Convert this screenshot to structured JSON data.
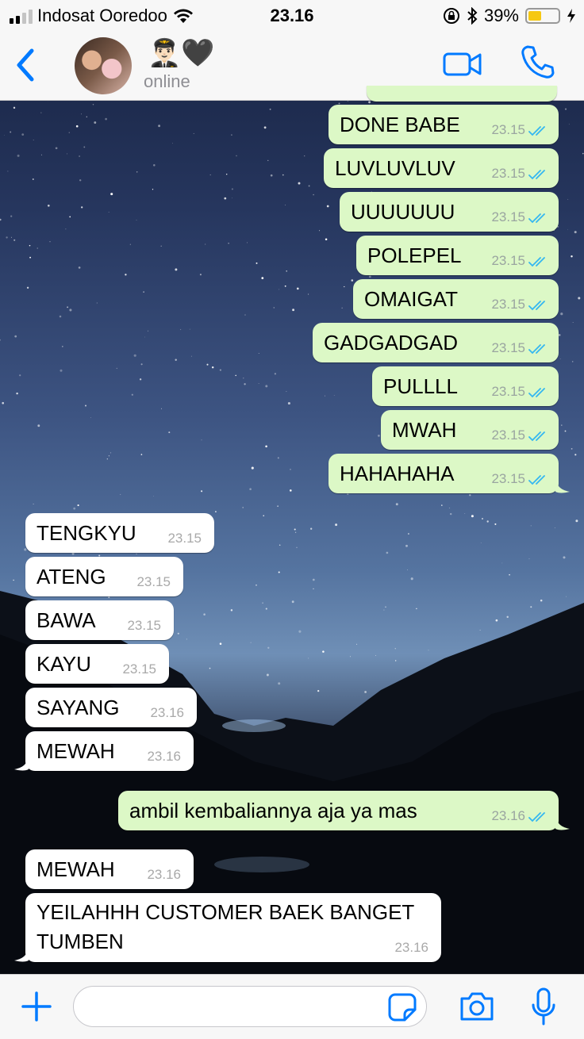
{
  "status_bar": {
    "carrier": "Indosat Ooredoo",
    "time": "23.16",
    "battery": "39%",
    "battery_level": 0.39,
    "icons": [
      "signal-icon",
      "wifi-icon",
      "orientation-lock-icon",
      "bluetooth-icon",
      "battery-icon",
      "charging-icon"
    ]
  },
  "header": {
    "back_icon": "chevron-left-icon",
    "contact_name": "👨🏻‍✈️🖤",
    "contact_status": "online",
    "video_icon": "video-camera-icon",
    "call_icon": "phone-icon"
  },
  "messages": [
    {
      "dir": "out",
      "text": "DONE BABE",
      "time": "23.15",
      "status": "read"
    },
    {
      "dir": "out",
      "text": "LUVLUVLUV",
      "time": "23.15",
      "status": "read"
    },
    {
      "dir": "out",
      "text": "UUUUUUU",
      "time": "23.15",
      "status": "read"
    },
    {
      "dir": "out",
      "text": "POLEPEL",
      "time": "23.15",
      "status": "read"
    },
    {
      "dir": "out",
      "text": "OMAIGAT",
      "time": "23.15",
      "status": "read"
    },
    {
      "dir": "out",
      "text": "GADGADGAD",
      "time": "23.15",
      "status": "read"
    },
    {
      "dir": "out",
      "text": "PULLLL",
      "time": "23.15",
      "status": "read"
    },
    {
      "dir": "out",
      "text": "MWAH",
      "time": "23.15",
      "status": "read"
    },
    {
      "dir": "out",
      "text": "HAHAHAHA",
      "time": "23.15",
      "status": "read"
    },
    {
      "dir": "in",
      "text": "TENGKYU",
      "time": "23.15"
    },
    {
      "dir": "in",
      "text": "ATENG",
      "time": "23.15"
    },
    {
      "dir": "in",
      "text": "BAWA",
      "time": "23.15"
    },
    {
      "dir": "in",
      "text": "KAYU",
      "time": "23.15"
    },
    {
      "dir": "in",
      "text": "SAYANG",
      "time": "23.16"
    },
    {
      "dir": "in",
      "text": "MEWAH",
      "time": "23.16"
    },
    {
      "dir": "out",
      "text": "ambil kembaliannya aja ya mas",
      "time": "23.16",
      "status": "read"
    },
    {
      "dir": "in",
      "text": "MEWAH",
      "time": "23.16"
    },
    {
      "dir": "in",
      "text": "YEILAHHH CUSTOMER BAEK BANGET TUMBEN",
      "time": "23.16"
    }
  ],
  "input_bar": {
    "add_icon": "plus-icon",
    "message_placeholder": "",
    "sticker_icon": "sticker-icon",
    "camera_icon": "camera-icon",
    "mic_icon": "microphone-icon"
  },
  "colors": {
    "accent": "#007aff",
    "outgoing_bubble": "#dcf8c6",
    "incoming_bubble": "#ffffff",
    "read_ticks": "#34b7f1"
  }
}
